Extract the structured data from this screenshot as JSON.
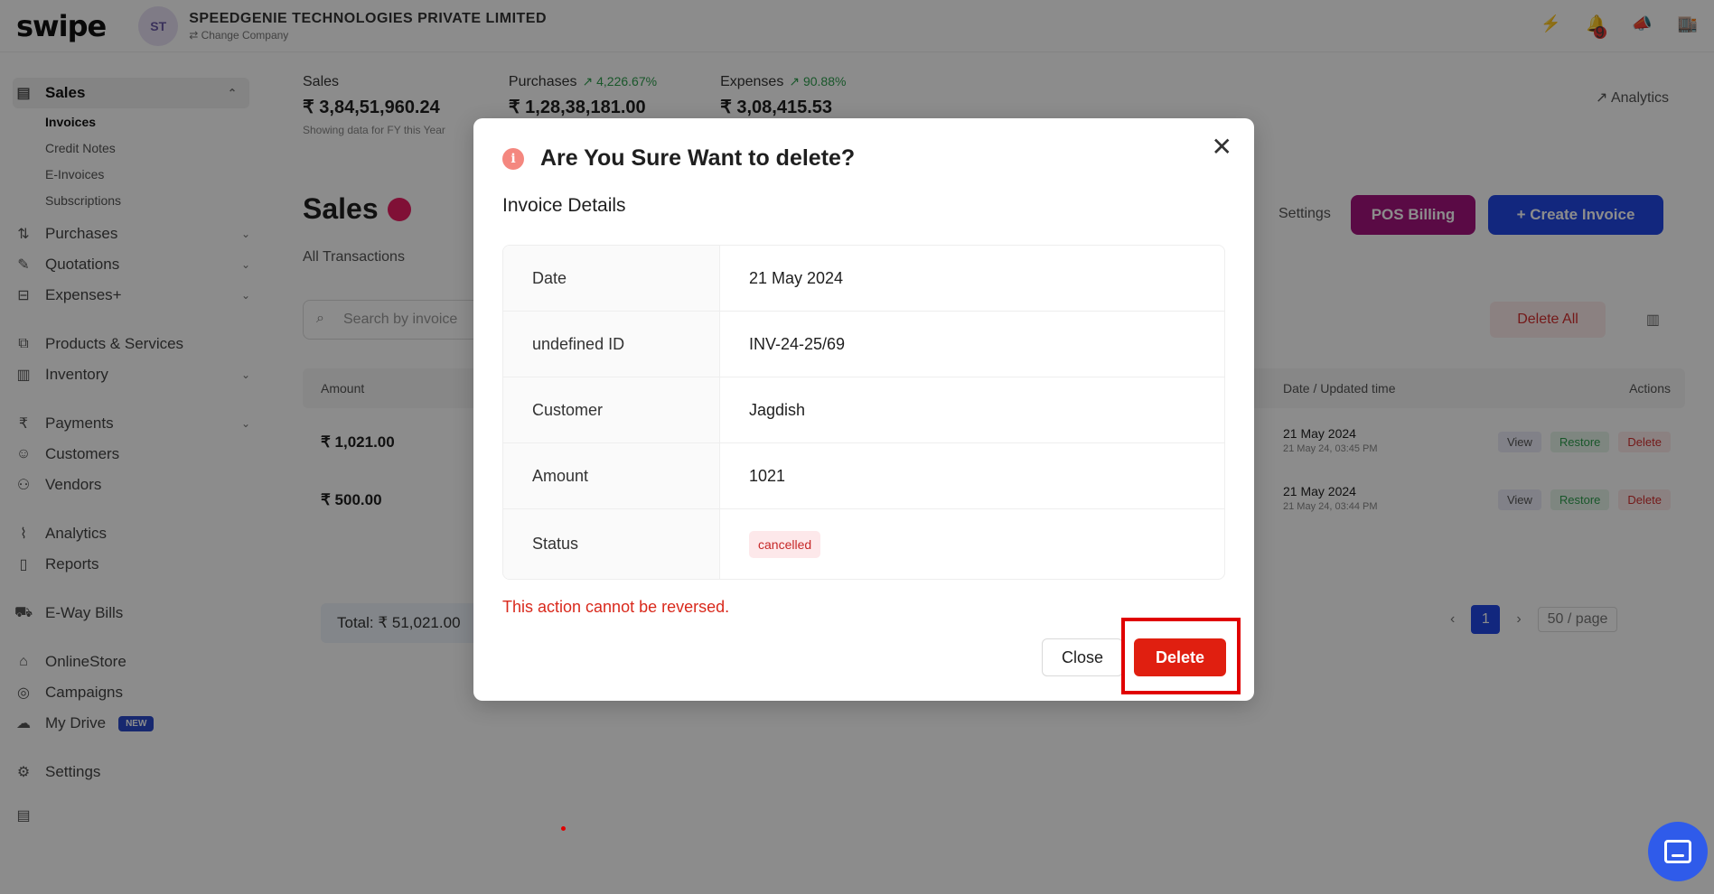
{
  "app": {
    "logo": "swipe",
    "company_initials": "ST",
    "company_name": "SPEEDGENIE TECHNOLOGIES PRIVATE LIMITED",
    "change_company": "⇄ Change Company",
    "notification_count": "9"
  },
  "sidebar": {
    "sales_label": "Sales",
    "sales_sub": [
      "Invoices",
      "Credit Notes",
      "E-Invoices",
      "Subscriptions"
    ],
    "purchases": "Purchases",
    "quotations": "Quotations",
    "expenses": "Expenses+",
    "products": "Products & Services",
    "inventory": "Inventory",
    "payments": "Payments",
    "customers": "Customers",
    "vendors": "Vendors",
    "analytics": "Analytics",
    "reports": "Reports",
    "ewaybills": "E-Way Bills",
    "onlinestore": "OnlineStore",
    "campaigns": "Campaigns",
    "mydrive": "My Drive",
    "new_badge": "NEW",
    "settings": "Settings"
  },
  "summary": {
    "sales_label": "Sales",
    "sales_value": "₹ 3,84,51,960.24",
    "sales_sub": "Showing data for FY this Year",
    "purchases_label": "Purchases",
    "purchases_trend": "↗ 4,226.67%",
    "purchases_value": "₹ 1,28,38,181.00",
    "expenses_label": "Expenses",
    "expenses_trend": "↗ 90.88%",
    "expenses_value": "₹ 3,08,415.53",
    "analytics_link": "Analytics"
  },
  "page": {
    "title": "Sales",
    "sub_tab": "All Transactions",
    "settings": "Settings",
    "pos_billing": "POS Billing",
    "create_invoice": "+ Create Invoice",
    "search_placeholder": "Search by invoice",
    "delete_all": "Delete All"
  },
  "table": {
    "col_amount": "Amount",
    "col_date": "Date / Updated time",
    "col_actions": "Actions",
    "rows": [
      {
        "amount": "₹ 1,021.00",
        "date": "21 May 2024",
        "time": "21 May 24, 03:45 PM"
      },
      {
        "amount": "₹ 500.00",
        "date": "21 May 2024",
        "time": "21 May 24, 03:44 PM"
      }
    ],
    "view": "View",
    "restore": "Restore",
    "delete": "Delete",
    "total": "Total: ₹ 51,021.00",
    "page_number": "1",
    "per_page": "50 / page"
  },
  "modal": {
    "title": "Are You Sure Want to delete?",
    "section_title": "Invoice Details",
    "rows": [
      {
        "label": "Date",
        "value": "21 May 2024"
      },
      {
        "label": "undefined ID",
        "value": "INV-24-25/69"
      },
      {
        "label": "Customer",
        "value": "Jagdish"
      },
      {
        "label": "Amount",
        "value": "1021"
      },
      {
        "label": "Status",
        "value": "cancelled"
      }
    ],
    "warning": "This action cannot be reversed.",
    "close_button": "Close",
    "delete_button": "Delete"
  },
  "icons": {
    "info": "info-circle-icon",
    "close": "close-x-icon",
    "chat": "chat-icon",
    "search": "search-icon"
  },
  "colors": {
    "danger": "#e01f10",
    "primary": "#2148e6",
    "pos": "#a4137f",
    "overlay": "rgba(0,0,0,0.45)"
  }
}
